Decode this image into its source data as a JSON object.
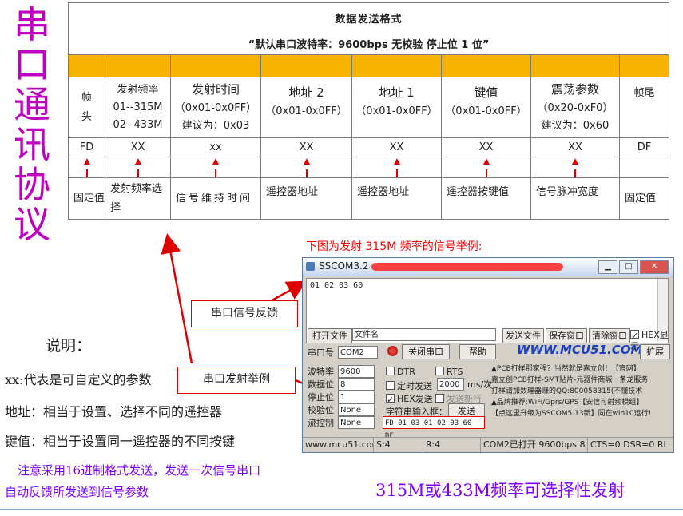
{
  "vertical_title": [
    "串",
    "口",
    "通",
    "讯",
    "协",
    "议"
  ],
  "table": {
    "title": "数据发送格式",
    "subtitle": "“默认串口波特率：9600bps   无校验   停止位 1 位”",
    "headers": [
      [
        "帧",
        "头"
      ],
      [
        "发射频率",
        "01--315M",
        "02--433M"
      ],
      [
        "发射时间",
        "（0x01-0x0FF）",
        "建议为：0x03"
      ],
      [
        "地址 2",
        "（0x01-0x0FF）"
      ],
      [
        "地址 1",
        "（0x01-0x0FF）"
      ],
      [
        "键值",
        "（0x01-0x0FF）"
      ],
      [
        "震荡参数",
        "（0x20-0xF0）",
        "建议为：0x60"
      ],
      [
        "帧尾"
      ]
    ],
    "values": [
      "FD",
      "XX",
      "xx",
      "XX",
      "XX",
      "XX",
      "XX",
      "DF"
    ],
    "descriptions": [
      "固定值",
      "发射频率选择",
      "信号维持时间",
      "遥控器地址",
      "遥控器地址",
      "遥控器按键值",
      "信号脉冲宽度",
      "固定值"
    ]
  },
  "example_caption": "下图为发射 315M 频率的信号举例:",
  "callout_feedback": "串口信号反馈",
  "callout_send": "串口发射举例",
  "notes": {
    "heading": "说明：",
    "xx": "xx:代表是可自定义的参数",
    "address": "地址：相当于设置、选择不同的遥控器",
    "key": "键值：相当于设置同一遥控器的不同按键",
    "hex_note_1": "注意采用16进制格式发送，发送一次信号串口",
    "hex_note_2": "自动反馈所发送到信号参数",
    "freq_note": "315M或433M频率可选择性发射"
  },
  "sscom": {
    "title": "SSCOM3.2",
    "received": "01 02 03 60",
    "open_file": "打开文件",
    "filename": "文件名",
    "send_file": "发送文件",
    "save_window": "保存窗口",
    "clear_window": "清除窗口",
    "hex_display": "HEX显示",
    "port_label": "串口号",
    "port_value": "COM2",
    "close_port": "关闭串口",
    "help": "帮助",
    "brand": "WWW.MCU51.COM",
    "expand": "扩展",
    "baud_label": "波特率",
    "baud_value": "9600",
    "data_label": "数据位",
    "data_value": "8",
    "stop_label": "停止位",
    "stop_value": "1",
    "parity_label": "校验位",
    "parity_value": "None",
    "flow_label": "流控制",
    "flow_value": "None",
    "dtr": "DTR",
    "rts": "RTS",
    "timed_send": "定时发送",
    "interval": "2000",
    "interval_unit": "ms/次",
    "hex_send": "HEX发送",
    "send_newline": "发送新行",
    "input_label": "字符串输入框：",
    "send": "发送",
    "send_value": "FD 01 03 01 02 03 60 DF",
    "ads": [
      "▲PCB打样那家强？当然就是嘉立创！【官网】",
      "嘉立创PCB打样-SMT贴片-元器件商城一条龙服务",
      "打样请加数理器赚的QQ:800058315(不懂技术",
      "▲品牌推荐:WiFi/Gprs/GPS【安信可射频模组】",
      "【点这里升级为SSCOM5.13新】同在win10运行!"
    ],
    "status": {
      "site": "www.mcu51.cor",
      "s": "S:4",
      "r": "R:4",
      "port_state": "COM2已打开  9600bps  8",
      "lines": "CTS=0 DSR=0 RL"
    }
  },
  "colors": {
    "accent_purple": "#c000c0",
    "table_band": "#f6b400",
    "red": "#ff0000",
    "note_purple": "#8000ff"
  }
}
